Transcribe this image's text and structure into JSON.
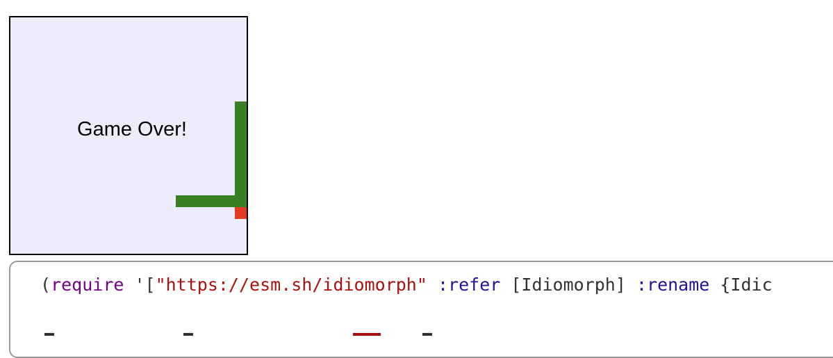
{
  "game": {
    "status_text": "Game Over!",
    "colors": {
      "board_background": "#ececfb",
      "snake": "#3a7f23",
      "food": "#e63b23",
      "board_border": "#000000"
    }
  },
  "code": {
    "line1_tokens": [
      {
        "text": "(",
        "kind": "paren"
      },
      {
        "text": "require",
        "kind": "fn"
      },
      {
        "text": " '[",
        "kind": "plain"
      },
      {
        "text": "\"https://esm.sh/idiomorph\"",
        "kind": "str"
      },
      {
        "text": " ",
        "kind": "plain"
      },
      {
        "text": ":refer",
        "kind": "kw"
      },
      {
        "text": " [Idiomorph] ",
        "kind": "plain"
      },
      {
        "text": ":rename",
        "kind": "kw"
      },
      {
        "text": " {Idic",
        "kind": "plain"
      }
    ]
  }
}
